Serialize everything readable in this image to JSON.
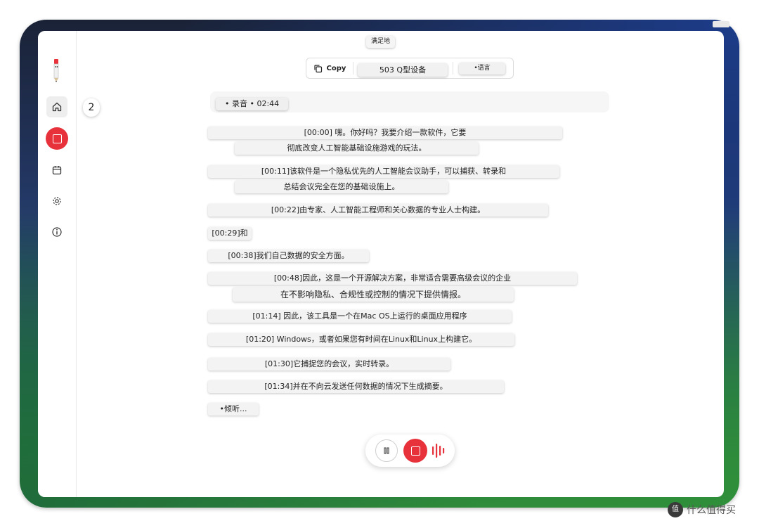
{
  "window": {
    "tooltip_top": "满足地"
  },
  "toolbar": {
    "copy_label": "Copy",
    "device_label": "503 Q型设备",
    "language_label": "•语言"
  },
  "badge": {
    "count": "2"
  },
  "recording_status": "• 录音 • 02:44",
  "transcript": [
    "[00:00] 嘿。你好吗？我要介绍一款软件，它要",
    "彻底改变人工智能基础设施游戏的玩法。",
    "[00:11]该软件是一个隐私优先的人工智能会议助手，可以捕获、转录和",
    "总结会议完全在您的基础设施上。",
    "[00:22]由专家、人工智能工程师和关心数据的专业人士构建。",
    "[00:29]和",
    "[00:38]我们自己数据的安全方面。",
    "[00:48]因此，这是一个开源解决方案，非常适合需要高级会议的企业",
    "在不影响隐私、合规性或控制的情况下提供情报。",
    "[01:14] 因此，该工具是一个在Mac OS上运行的桌面应用程序",
    "[01:20] Windows，或者如果您有时间在Linux和Linux上构建它。",
    "[01:30]它捕捉您的会议，实时转录。",
    "[01:34]并在不向云发送任何数据的情况下生成摘要。"
  ],
  "listening_label": "•倾听...",
  "watermark": {
    "logo_text": "值",
    "text": "什么值得买"
  },
  "sidebar_icons": [
    "home-icon",
    "record-icon",
    "calendar-icon",
    "gear-icon",
    "info-icon"
  ],
  "colors": {
    "record_red": "#e8323b",
    "window_bg": "#ffffff"
  }
}
